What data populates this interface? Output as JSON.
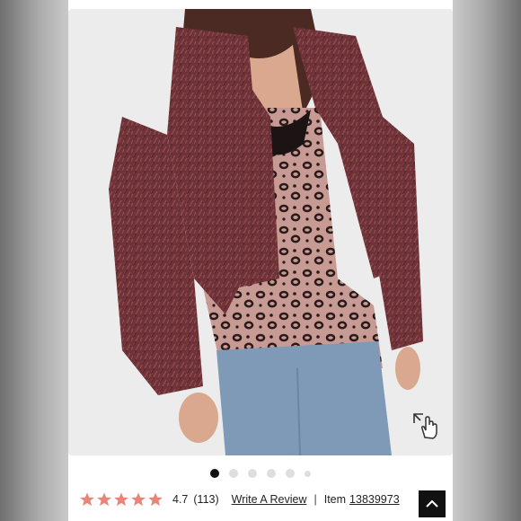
{
  "product": {
    "rating_value": "4.7",
    "review_count": "(113)",
    "write_review_label": "Write A Review",
    "separator": "|",
    "item_label": "Item",
    "item_number": "13839973",
    "star_count": 5,
    "star_color": "#e8847a"
  },
  "carousel": {
    "total_dots": 6,
    "active_index": 0
  },
  "icons": {
    "zoom": "hand-expand-icon",
    "back_to_top": "chevron-up-icon"
  }
}
